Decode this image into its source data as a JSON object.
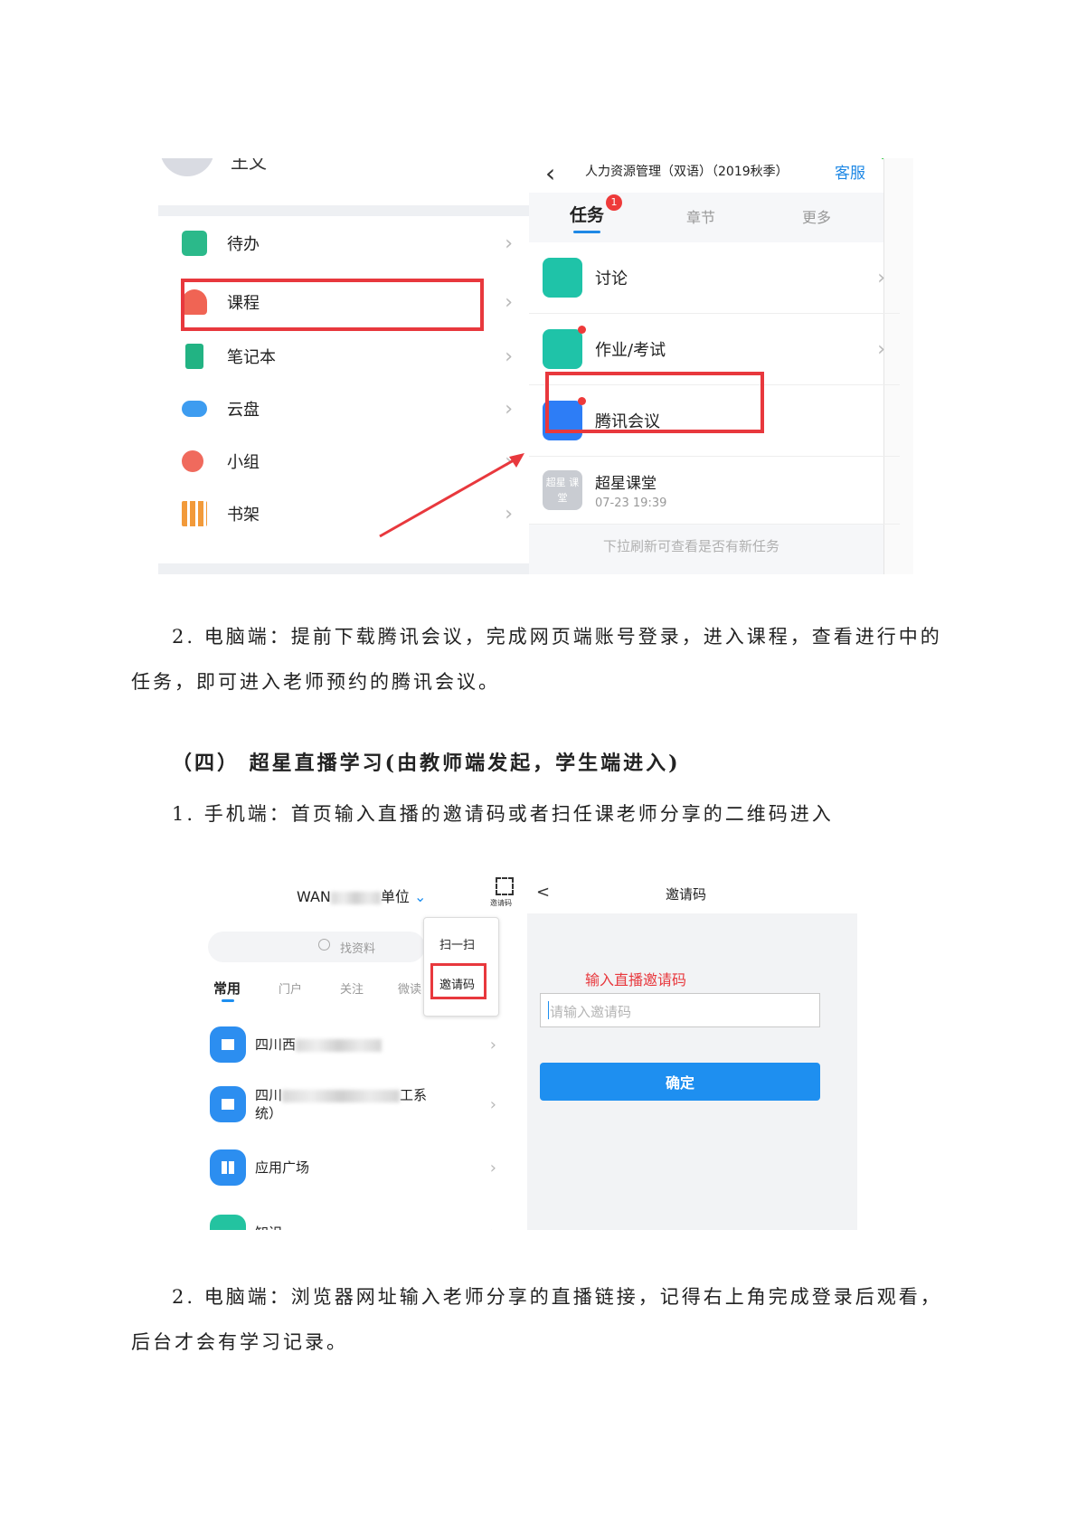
{
  "shot1": {
    "profile_name": "王文",
    "menu": [
      {
        "label": "待办",
        "icon": "todo-icon",
        "color": "#2bb98a"
      },
      {
        "label": "课程",
        "icon": "course-icon",
        "color": "#f06454"
      },
      {
        "label": "笔记本",
        "icon": "notebook-icon",
        "color": "#22b383"
      },
      {
        "label": "云盘",
        "icon": "cloud-icon",
        "color": "#3d9cf0"
      },
      {
        "label": "小组",
        "icon": "group-icon",
        "color": "#f06a5d"
      },
      {
        "label": "书架",
        "icon": "bookshelf-icon",
        "color": "#f29a3a"
      }
    ],
    "course_title": "人力资源管理（双语）（2019秋季）",
    "service_label": "客服",
    "tabs": [
      "任务",
      "章节",
      "更多"
    ],
    "tab_badge": "1",
    "tasks": [
      {
        "label": "讨论",
        "icon": "discussion-icon",
        "color": "#1fc3a8"
      },
      {
        "label": "作业/考试",
        "icon": "homework-icon",
        "color": "#1fc3a8"
      },
      {
        "label": "腾讯会议",
        "icon": "tencent-meeting-icon",
        "color": "#2d7df6"
      }
    ],
    "live_item": {
      "title": "超星课堂",
      "time": "07-23 19:39",
      "icon_text": "超星 课堂"
    },
    "refresh_hint": "下拉刷新可查看是否有新任务",
    "highlight_color": "#e8383d"
  },
  "para1_line1": "2.  电脑端：提前下载腾讯会议，完成网页端账号登录，进入课程，查看进行中的",
  "para1_line2": "任务，即可进入老师预约的腾讯会议。",
  "section_heading": "（四） 超星直播学习(由教师端发起，学生端进入)",
  "para2": "1.  手机端：首页输入直播的邀请码或者扫任课老师分享的二维码进入",
  "shot2": {
    "unit_label_prefix": "WAN",
    "unit_label_suffix": "单位",
    "scan_icon_caption": "邀请码",
    "search_placeholder": "找资料",
    "tabs": [
      "常用",
      "门户",
      "关注",
      "微读"
    ],
    "popup": [
      "扫一扫",
      "邀请码"
    ],
    "apps": [
      {
        "label": "四川西",
        "icon": "home-icon"
      },
      {
        "label_line1_prefix": "四川",
        "label_line1_suffix": "工系",
        "label_line2": "统）",
        "icon": "home-icon"
      },
      {
        "label": "应用广场",
        "icon": "app-grid-icon"
      },
      {
        "label": "知识",
        "icon": "knowledge-icon"
      }
    ],
    "back_symbol": "<",
    "page_title": "邀请码",
    "instruction": "输入直播邀请码",
    "input_placeholder": "请输入邀请码",
    "confirm_label": "确定",
    "accent": "#1e8ff0"
  },
  "para3_line1": "2.  电脑端：浏览器网址输入老师分享的直播链接，记得右上角完成登录后观看，",
  "para3_line2": "后台才会有学习记录。"
}
